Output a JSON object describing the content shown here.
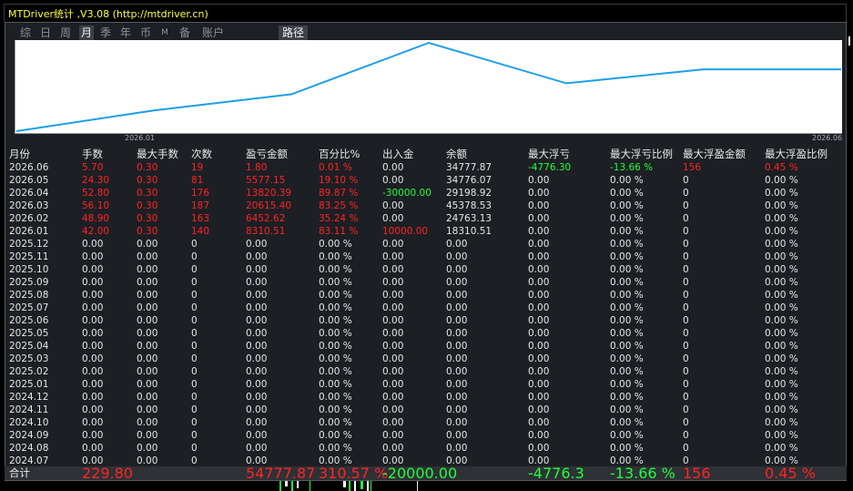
{
  "window": {
    "title": "MTDriver统计 ,V3.08 (http://mtdriver.cn)"
  },
  "tabs": [
    {
      "label": "综",
      "name": "tab-zong"
    },
    {
      "label": "日",
      "name": "tab-day"
    },
    {
      "label": "周",
      "name": "tab-week"
    },
    {
      "label": "月",
      "name": "tab-month",
      "active": true
    },
    {
      "label": "季",
      "name": "tab-quarter"
    },
    {
      "label": "年",
      "name": "tab-year"
    },
    {
      "label": "币",
      "name": "tab-currency"
    },
    {
      "label": "M",
      "name": "tab-m",
      "small": true
    },
    {
      "label": "备",
      "name": "tab-backup"
    },
    {
      "label": "账户",
      "name": "tab-account"
    },
    {
      "label": "路径",
      "name": "tab-path",
      "active": true
    }
  ],
  "chart_data": {
    "type": "line",
    "x_tick_labels": [
      "2026.01",
      "2026.06"
    ],
    "x": [
      "2026.01",
      "2026.02",
      "2026.03",
      "2026.04",
      "2026.05",
      "2026.06"
    ],
    "points": [
      {
        "x": "2026.01",
        "y": 10000.0
      },
      {
        "x": "2026.01",
        "y": 18310.51
      },
      {
        "x": "2026.02",
        "y": 24763.13
      },
      {
        "x": "2026.03",
        "y": 45378.53
      },
      {
        "x": "2026.04",
        "y": 29198.92
      },
      {
        "x": "2026.05",
        "y": 34776.07
      },
      {
        "x": "2026.06",
        "y": 34777.87
      }
    ],
    "line_color": "#1e9fe6"
  },
  "table": {
    "headers": [
      "月份",
      "手数",
      "最大手数",
      "次数",
      "盈亏金额",
      "百分比%",
      "出入金",
      "余额",
      "最大浮亏",
      "最大浮亏比例",
      "最大浮盈金额",
      "最大浮盈比例"
    ],
    "rows": [
      [
        "2026.06",
        "5.70",
        "0.30",
        "19",
        "1.80",
        "0.01 %",
        "0.00",
        "34777.87",
        "-4776.30",
        "-13.66 %",
        "156",
        "0.45 %"
      ],
      [
        "2026.05",
        "24.30",
        "0.30",
        "81",
        "5577.15",
        "19.10 %",
        "0.00",
        "34776.07",
        "0.00",
        "0.00 %",
        "0",
        "0.00 %"
      ],
      [
        "2026.04",
        "52.80",
        "0.30",
        "176",
        "13820.39",
        "89.87 %",
        "-30000.00",
        "29198.92",
        "0.00",
        "0.00 %",
        "0",
        "0.00 %"
      ],
      [
        "2026.03",
        "56.10",
        "0.30",
        "187",
        "20615.40",
        "83.25 %",
        "0.00",
        "45378.53",
        "0.00",
        "0.00 %",
        "0",
        "0.00 %"
      ],
      [
        "2026.02",
        "48.90",
        "0.30",
        "163",
        "6452.62",
        "35.24 %",
        "0.00",
        "24763.13",
        "0.00",
        "0.00 %",
        "0",
        "0.00 %"
      ],
      [
        "2026.01",
        "42.00",
        "0.30",
        "140",
        "8310.51",
        "83.11 %",
        "10000.00",
        "18310.51",
        "0.00",
        "0.00 %",
        "0",
        "0.00 %"
      ],
      [
        "2025.12",
        "0.00",
        "0.00",
        "0",
        "0.00",
        "0.00 %",
        "0.00",
        "0.00",
        "0.00",
        "0.00 %",
        "0",
        "0.00 %"
      ],
      [
        "2025.11",
        "0.00",
        "0.00",
        "0",
        "0.00",
        "0.00 %",
        "0.00",
        "0.00",
        "0.00",
        "0.00 %",
        "0",
        "0.00 %"
      ],
      [
        "2025.10",
        "0.00",
        "0.00",
        "0",
        "0.00",
        "0.00 %",
        "0.00",
        "0.00",
        "0.00",
        "0.00 %",
        "0",
        "0.00 %"
      ],
      [
        "2025.09",
        "0.00",
        "0.00",
        "0",
        "0.00",
        "0.00 %",
        "0.00",
        "0.00",
        "0.00",
        "0.00 %",
        "0",
        "0.00 %"
      ],
      [
        "2025.08",
        "0.00",
        "0.00",
        "0",
        "0.00",
        "0.00 %",
        "0.00",
        "0.00",
        "0.00",
        "0.00 %",
        "0",
        "0.00 %"
      ],
      [
        "2025.07",
        "0.00",
        "0.00",
        "0",
        "0.00",
        "0.00 %",
        "0.00",
        "0.00",
        "0.00",
        "0.00 %",
        "0",
        "0.00 %"
      ],
      [
        "2025.06",
        "0.00",
        "0.00",
        "0",
        "0.00",
        "0.00 %",
        "0.00",
        "0.00",
        "0.00",
        "0.00 %",
        "0",
        "0.00 %"
      ],
      [
        "2025.05",
        "0.00",
        "0.00",
        "0",
        "0.00",
        "0.00 %",
        "0.00",
        "0.00",
        "0.00",
        "0.00 %",
        "0",
        "0.00 %"
      ],
      [
        "2025.04",
        "0.00",
        "0.00",
        "0",
        "0.00",
        "0.00 %",
        "0.00",
        "0.00",
        "0.00",
        "0.00 %",
        "0",
        "0.00 %"
      ],
      [
        "2025.03",
        "0.00",
        "0.00",
        "0",
        "0.00",
        "0.00 %",
        "0.00",
        "0.00",
        "0.00",
        "0.00 %",
        "0",
        "0.00 %"
      ],
      [
        "2025.02",
        "0.00",
        "0.00",
        "0",
        "0.00",
        "0.00 %",
        "0.00",
        "0.00",
        "0.00",
        "0.00 %",
        "0",
        "0.00 %"
      ],
      [
        "2025.01",
        "0.00",
        "0.00",
        "0",
        "0.00",
        "0.00 %",
        "0.00",
        "0.00",
        "0.00",
        "0.00 %",
        "0",
        "0.00 %"
      ],
      [
        "2024.12",
        "0.00",
        "0.00",
        "0",
        "0.00",
        "0.00 %",
        "0.00",
        "0.00",
        "0.00",
        "0.00 %",
        "0",
        "0.00 %"
      ],
      [
        "2024.11",
        "0.00",
        "0.00",
        "0",
        "0.00",
        "0.00 %",
        "0.00",
        "0.00",
        "0.00",
        "0.00 %",
        "0",
        "0.00 %"
      ],
      [
        "2024.10",
        "0.00",
        "0.00",
        "0",
        "0.00",
        "0.00 %",
        "0.00",
        "0.00",
        "0.00",
        "0.00 %",
        "0",
        "0.00 %"
      ],
      [
        "2024.09",
        "0.00",
        "0.00",
        "0",
        "0.00",
        "0.00 %",
        "0.00",
        "0.00",
        "0.00",
        "0.00 %",
        "0",
        "0.00 %"
      ],
      [
        "2024.08",
        "0.00",
        "0.00",
        "0",
        "0.00",
        "0.00 %",
        "0.00",
        "0.00",
        "0.00",
        "0.00 %",
        "0",
        "0.00 %"
      ],
      [
        "2024.07",
        "0.00",
        "0.00",
        "0",
        "0.00",
        "0.00 %",
        "0.00",
        "0.00",
        "0.00",
        "0.00 %",
        "0",
        "0.00 %"
      ]
    ],
    "total": [
      "合计",
      "229.80",
      "",
      "",
      "54777.87",
      "310.57 %",
      "-20000.00",
      "",
      "-4776.3",
      "-13.66 %",
      "156",
      "0.45 %"
    ]
  },
  "colors": {
    "positive": "#ff2424",
    "negative": "#20ff3c",
    "neutral": "#e6e6e6",
    "title": "#ffff3a",
    "panel": "#1c1f24"
  }
}
